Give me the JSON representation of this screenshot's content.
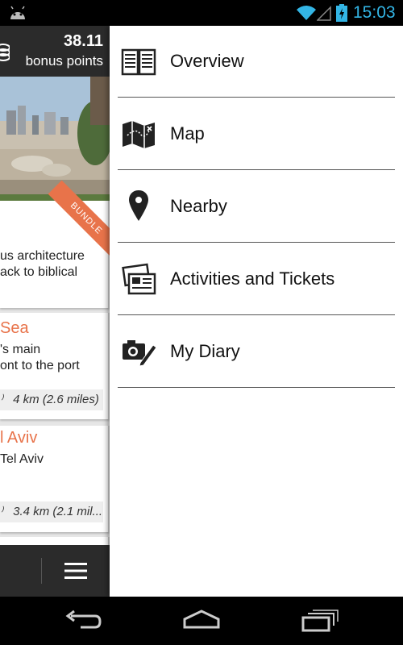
{
  "status_bar": {
    "time": "15:03"
  },
  "left_screen": {
    "bonus_value": "38.11",
    "bonus_label": "bonus points",
    "card1": {
      "ribbon": "BUNDLE",
      "line1": "us architecture",
      "line2": "ack to biblical"
    },
    "card2": {
      "title": "Sea",
      "line1": "'s main",
      "line2": "ont to the port",
      "distance": "4 km (2.6 miles)"
    },
    "card3": {
      "title": "l Aviv",
      "line1": "Tel Aviv",
      "distance": "3.4 km (2.1 mil..."
    }
  },
  "drawer": {
    "items": [
      {
        "label": "Overview",
        "icon": "book-icon"
      },
      {
        "label": "Map",
        "icon": "map-icon"
      },
      {
        "label": "Nearby",
        "icon": "location-pin-icon"
      },
      {
        "label": "Activities and Tickets",
        "icon": "tickets-icon"
      },
      {
        "label": "My Diary",
        "icon": "camera-pencil-icon"
      }
    ]
  },
  "colors": {
    "accent_orange": "#e8734a",
    "holo_blue": "#33b5e5",
    "header_dark": "#2b2b2b"
  }
}
